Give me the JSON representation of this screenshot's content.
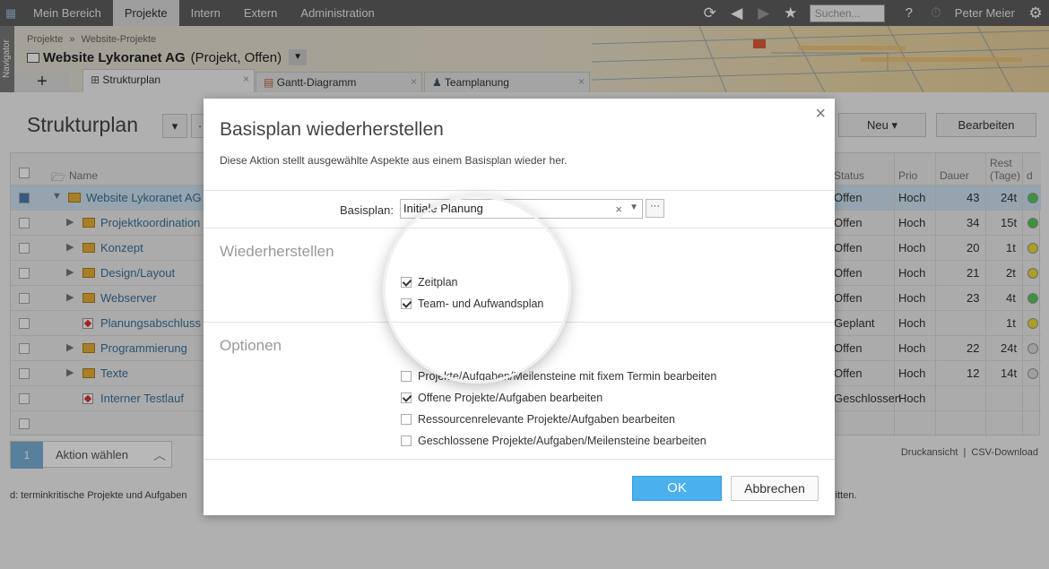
{
  "topnav": {
    "tabs": [
      "Mein Bereich",
      "Projekte",
      "Intern",
      "Extern",
      "Administration"
    ],
    "search_placeholder": "Suchen...",
    "help": "?",
    "user": "Peter Meier"
  },
  "navigator": "Navigator",
  "breadcrumb": {
    "a": "Projekte",
    "sep": "»",
    "b": "Website-Projekte"
  },
  "project": {
    "name": "Website Lykoranet AG",
    "status": "(Projekt, Offen)"
  },
  "tabs": {
    "add": "+",
    "t1": "Strukturplan",
    "t2": "Gantt-Diagramm",
    "t3": "Teamplanung"
  },
  "page": {
    "title": "Strukturplan",
    "new_label": "Neu",
    "edit_label": "Bearbeiten"
  },
  "grid": {
    "columns": {
      "name": "Name",
      "status": "Status",
      "prio": "Prio",
      "dauer": "Dauer",
      "rest": "Rest (Tage)",
      "d": "d"
    },
    "rows": [
      {
        "name": "Website Lykoranet AG",
        "status": "Offen",
        "prio": "Hoch",
        "dauer": "43",
        "rest": "24t",
        "dot": "green"
      },
      {
        "name": "Projektkoordination",
        "status": "Offen",
        "prio": "Hoch",
        "dauer": "34",
        "rest": "15t",
        "dot": "green"
      },
      {
        "name": "Konzept",
        "status": "Offen",
        "prio": "Hoch",
        "dauer": "20",
        "rest": "1t",
        "dot": "yellow"
      },
      {
        "name": "Design/Layout",
        "status": "Offen",
        "prio": "Hoch",
        "dauer": "21",
        "rest": "2t",
        "dot": "yellow"
      },
      {
        "name": "Webserver",
        "status": "Offen",
        "prio": "Hoch",
        "dauer": "23",
        "rest": "4t",
        "dot": "green"
      },
      {
        "name": "Planungsabschluss",
        "status": "Geplant",
        "prio": "Hoch",
        "dauer": "",
        "rest": "1t",
        "dot": "yellow"
      },
      {
        "name": "Programmierung",
        "status": "Offen",
        "prio": "Hoch",
        "dauer": "22",
        "rest": "24t",
        "dot": "grey"
      },
      {
        "name": "Texte",
        "status": "Offen",
        "prio": "Hoch",
        "dauer": "12",
        "rest": "14t",
        "dot": "grey"
      },
      {
        "name": "Interner Testlauf",
        "status": "Geschlossen",
        "prio": "Hoch",
        "dauer": "",
        "rest": "",
        "dot": ""
      }
    ]
  },
  "step": {
    "num": "1",
    "label": "Aktion wählen"
  },
  "links": {
    "print": "Druckansicht",
    "sep": "|",
    "csv": "CSV-Download"
  },
  "legend": {
    "left": "d: terminkritische Projekte und Aufgaben",
    "right": "ritten."
  },
  "dialog": {
    "title": "Basisplan wiederherstellen",
    "desc": "Diese Aktion stellt ausgewählte Aspekte aus einem Basisplan wieder her.",
    "close": "×",
    "basisplan_label": "Basisplan:",
    "basisplan_value": "Initiale Planung",
    "more": "···",
    "section_restore": "Wiederherstellen",
    "restore": [
      {
        "label": "Zeitplan",
        "checked": true
      },
      {
        "label": "Team- und Aufwandsplan",
        "checked": true
      }
    ],
    "section_options": "Optionen",
    "options": [
      {
        "label": "Projekte/Aufgaben/Meilensteine mit fixem Termin bearbeiten",
        "checked": false
      },
      {
        "label": "Offene Projekte/Aufgaben bearbeiten",
        "checked": true
      },
      {
        "label": "Ressourcenrelevante Projekte/Aufgaben bearbeiten",
        "checked": false
      },
      {
        "label": "Geschlossene Projekte/Aufgaben/Meilensteine bearbeiten",
        "checked": false
      }
    ],
    "ok": "OK",
    "cancel": "Abbrechen"
  },
  "colors": {
    "accent": "#4ab0ee",
    "topbar": "#5f5f5f",
    "link": "#39739b"
  }
}
